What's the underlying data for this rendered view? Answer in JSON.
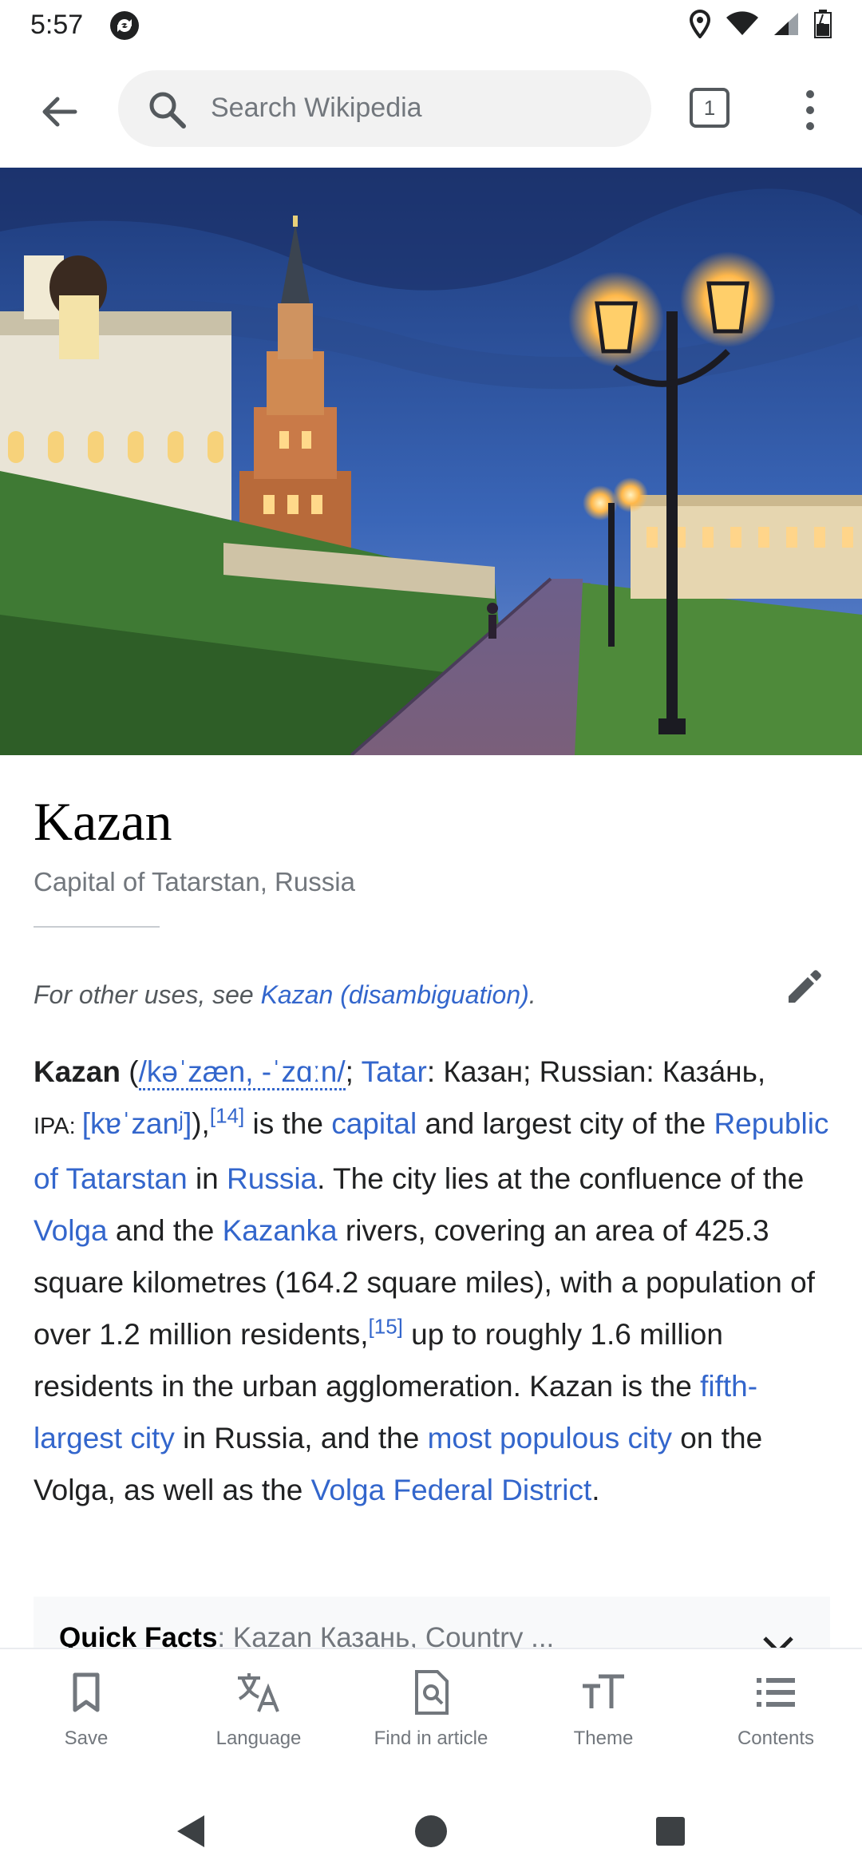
{
  "status_bar": {
    "time": "5:57"
  },
  "toolbar": {
    "search_placeholder": "Search Wikipedia",
    "tab_count": "1"
  },
  "article": {
    "title": "Kazan",
    "description": "Capital of Tatarstan, Russia",
    "hatnote_prefix": "For other uses, see ",
    "hatnote_link": "Kazan (disambiguation)",
    "hatnote_suffix": ".",
    "p": {
      "t1": "Kazan",
      "t2": " (",
      "ipa1": "/kəˈzæn, -ˈzɑːn/",
      "t3": "; ",
      "tatar": "Tatar",
      "t4": ": Казан; Russian: Каза́нь,",
      "ipa_label": "IPA: ",
      "ipa2": "[kɐˈzanʲ]",
      "t5": "),",
      "ref14": "[14]",
      "t6": " is the ",
      "capital": "capital",
      "t7": " and largest city of the ",
      "rot": "Republic of Tatarstan",
      "t8": " in ",
      "russia": "Russia",
      "t9": ". The city lies at the confluence of the ",
      "volga": "Volga",
      "t10": " and the ",
      "kazanka": "Kazanka",
      "t11": " rivers, covering an area of 425.3 square kilometres (164.2 square miles), with a population of over 1.2 million residents,",
      "ref15": "[15]",
      "t12": " up to roughly 1.6 million residents in the urban agglomeration. Kazan is the ",
      "fifth": "fifth-largest city",
      "t13": " in Russia, and the ",
      "most_pop": "most populous city",
      "t14": " on the Volga, as well as the ",
      "vfd": "Volga Federal District",
      "t15": "."
    },
    "quick_facts": {
      "label": "Quick Facts",
      "value": ": Kazan Казань, Country ..."
    }
  },
  "bottom_nav": [
    {
      "label": "Save",
      "icon": "bookmark-icon"
    },
    {
      "label": "Language",
      "icon": "translate-icon"
    },
    {
      "label": "Find in article",
      "icon": "find-in-page-icon"
    },
    {
      "label": "Theme",
      "icon": "text-size-icon"
    },
    {
      "label": "Contents",
      "icon": "list-icon"
    }
  ],
  "colors": {
    "link": "#3366cc",
    "text": "#202122",
    "muted": "#72777d"
  }
}
